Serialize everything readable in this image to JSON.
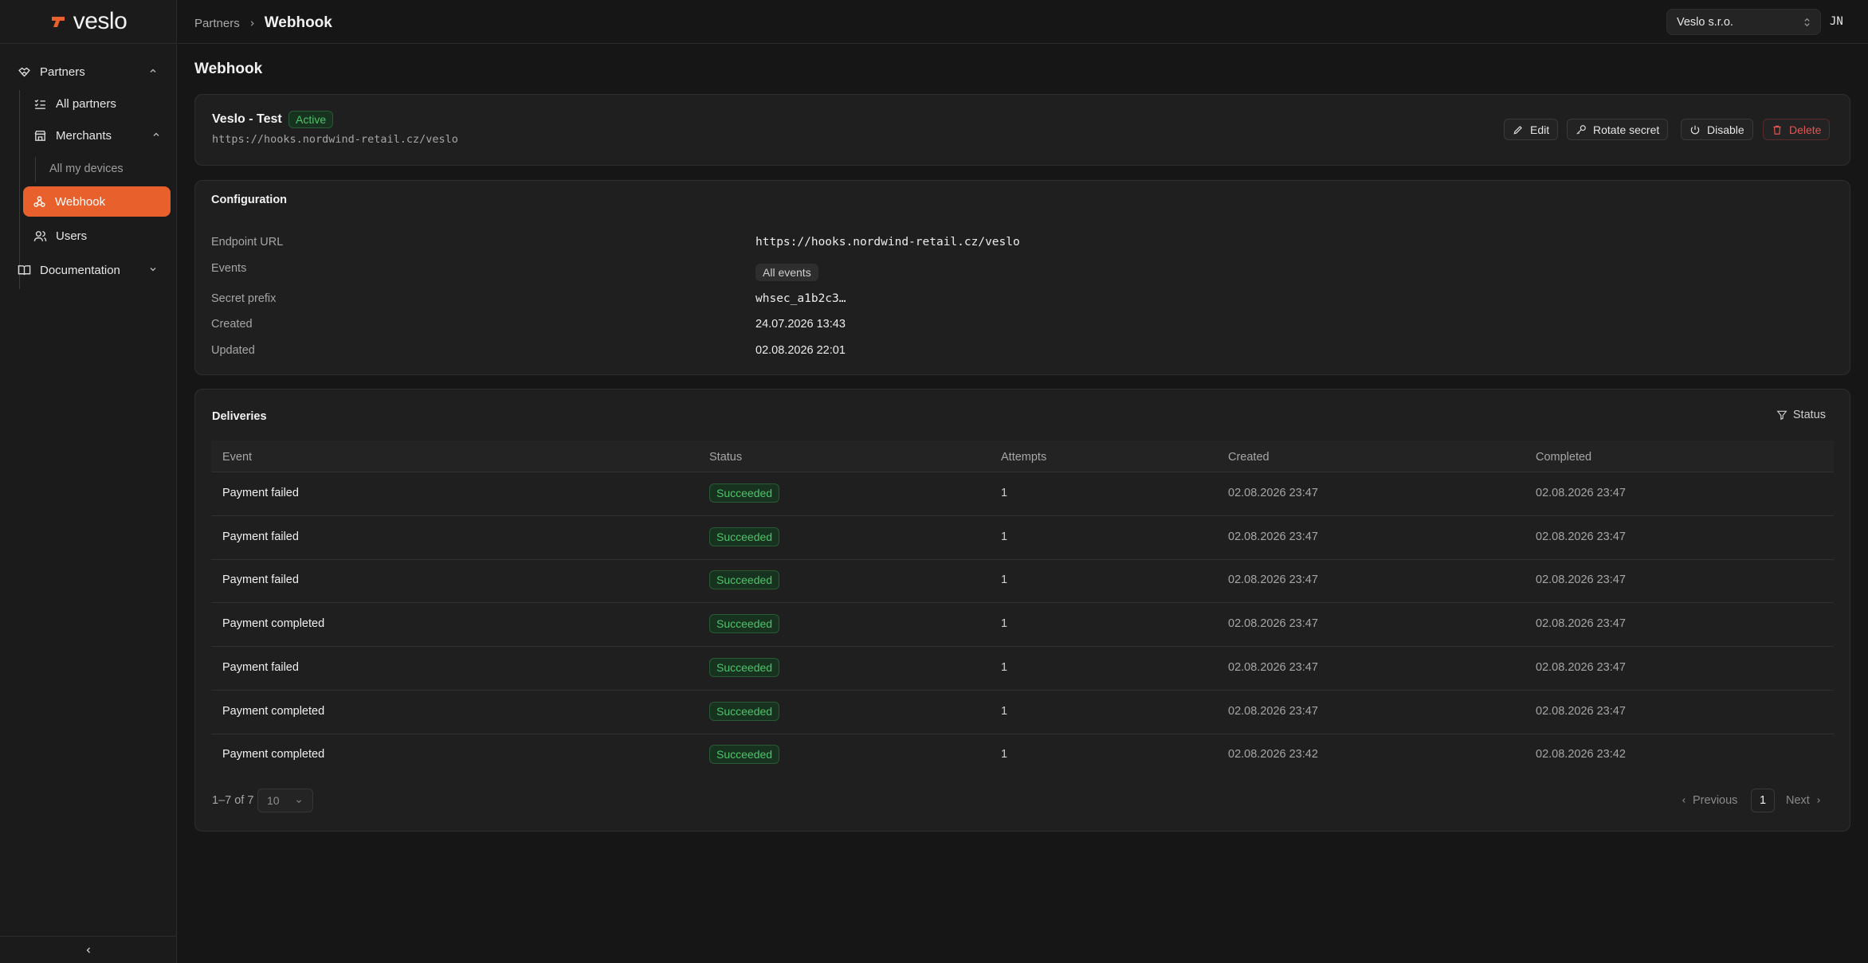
{
  "brand": {
    "name": "veslo",
    "color": "#e8612c"
  },
  "sidebar": {
    "partners_label": "Partners",
    "all_partners_label": "All partners",
    "merchants_label": "Merchants",
    "all_my_devices_label": "All my devices",
    "webhook_label": "Webhook",
    "users_label": "Users",
    "documentation_label": "Documentation"
  },
  "breadcrumb": {
    "parent": "Partners",
    "current": "Webhook"
  },
  "org_selector": {
    "value": "Veslo s.r.o."
  },
  "user_initials": "JN",
  "page_title": "Webhook",
  "webhook": {
    "name": "Veslo - Test",
    "status": "Active",
    "url": "https://hooks.nordwind-retail.cz/veslo",
    "actions": {
      "edit": "Edit",
      "rotate": "Rotate secret",
      "disable": "Disable",
      "delete": "Delete"
    }
  },
  "configuration": {
    "title": "Configuration",
    "endpoint_label": "Endpoint URL",
    "endpoint_value": "https://hooks.nordwind-retail.cz/veslo",
    "events_label": "Events",
    "events_value": "All events",
    "secret_label": "Secret prefix",
    "secret_value": "whsec_a1b2c3…",
    "created_label": "Created",
    "created_value": "24.07.2026 13:43",
    "updated_label": "Updated",
    "updated_value": "02.08.2026 22:01"
  },
  "deliveries": {
    "title": "Deliveries",
    "filter_label": "Status",
    "columns": [
      "Event",
      "Status",
      "Attempts",
      "Created",
      "Completed"
    ],
    "rows": [
      {
        "event": "Payment failed",
        "status": "Succeeded",
        "attempts": "1",
        "created": "02.08.2026 23:47",
        "completed": "02.08.2026 23:47"
      },
      {
        "event": "Payment failed",
        "status": "Succeeded",
        "attempts": "1",
        "created": "02.08.2026 23:47",
        "completed": "02.08.2026 23:47"
      },
      {
        "event": "Payment failed",
        "status": "Succeeded",
        "attempts": "1",
        "created": "02.08.2026 23:47",
        "completed": "02.08.2026 23:47"
      },
      {
        "event": "Payment completed",
        "status": "Succeeded",
        "attempts": "1",
        "created": "02.08.2026 23:47",
        "completed": "02.08.2026 23:47"
      },
      {
        "event": "Payment failed",
        "status": "Succeeded",
        "attempts": "1",
        "created": "02.08.2026 23:47",
        "completed": "02.08.2026 23:47"
      },
      {
        "event": "Payment completed",
        "status": "Succeeded",
        "attempts": "1",
        "created": "02.08.2026 23:47",
        "completed": "02.08.2026 23:47"
      },
      {
        "event": "Payment completed",
        "status": "Succeeded",
        "attempts": "1",
        "created": "02.08.2026 23:42",
        "completed": "02.08.2026 23:42"
      }
    ],
    "pagination": {
      "range": "1–7 of 7",
      "page_size": "10",
      "previous": "Previous",
      "page": "1",
      "next": "Next"
    }
  }
}
